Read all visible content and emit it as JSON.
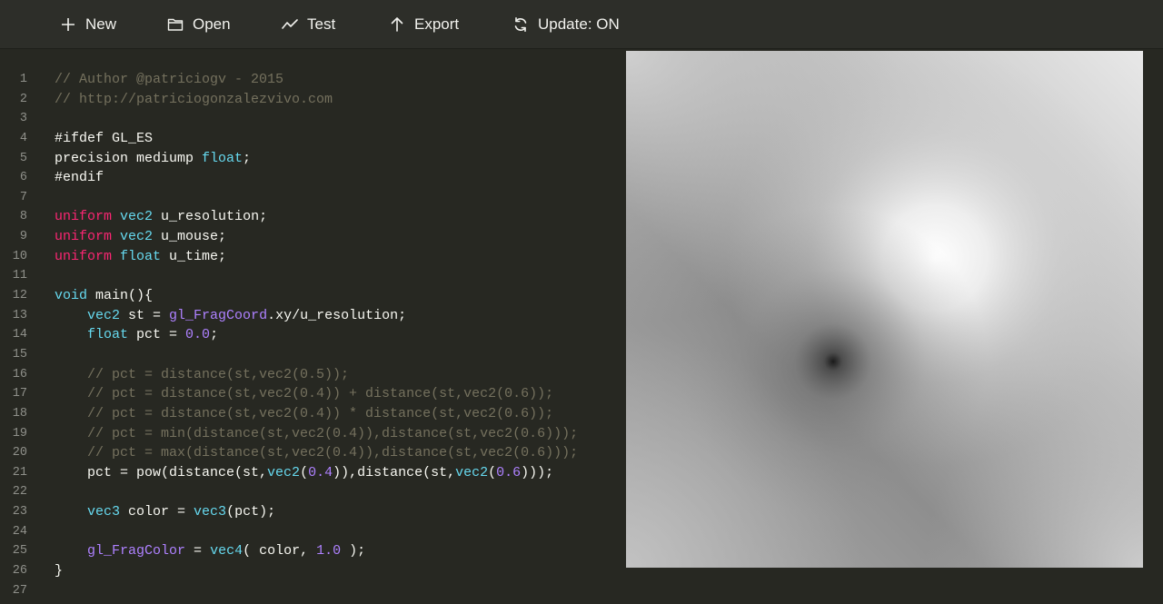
{
  "toolbar": {
    "new_label": "New",
    "open_label": "Open",
    "test_label": "Test",
    "export_label": "Export",
    "update_label": "Update: ON"
  },
  "editor": {
    "line_numbers": [
      "1",
      "2",
      "3",
      "4",
      "5",
      "6",
      "7",
      "8",
      "9",
      "10",
      "11",
      "12",
      "13",
      "14",
      "15",
      "16",
      "17",
      "18",
      "19",
      "20",
      "21",
      "22",
      "23",
      "24",
      "25",
      "26",
      "27"
    ],
    "lines": [
      [
        {
          "t": "// Author @patriciogv - 2015",
          "c": "comment"
        }
      ],
      [
        {
          "t": "// http://patriciogonzalezvivo.com",
          "c": "comment"
        }
      ],
      [],
      [
        {
          "t": "#ifdef GL_ES",
          "c": "plain"
        }
      ],
      [
        {
          "t": "precision mediump ",
          "c": "plain"
        },
        {
          "t": "float",
          "c": "type"
        },
        {
          "t": ";",
          "c": "plain"
        }
      ],
      [
        {
          "t": "#endif",
          "c": "plain"
        }
      ],
      [],
      [
        {
          "t": "uniform",
          "c": "kw"
        },
        {
          "t": " ",
          "c": "plain"
        },
        {
          "t": "vec2",
          "c": "type"
        },
        {
          "t": " u_resolution;",
          "c": "plain"
        }
      ],
      [
        {
          "t": "uniform",
          "c": "kw"
        },
        {
          "t": " ",
          "c": "plain"
        },
        {
          "t": "vec2",
          "c": "type"
        },
        {
          "t": " u_mouse;",
          "c": "plain"
        }
      ],
      [
        {
          "t": "uniform",
          "c": "kw"
        },
        {
          "t": " ",
          "c": "plain"
        },
        {
          "t": "float",
          "c": "type"
        },
        {
          "t": " u_time;",
          "c": "plain"
        }
      ],
      [],
      [
        {
          "t": "void",
          "c": "type"
        },
        {
          "t": " main(){",
          "c": "plain"
        }
      ],
      [
        {
          "t": "    ",
          "c": "plain"
        },
        {
          "t": "vec2",
          "c": "type"
        },
        {
          "t": " st = ",
          "c": "plain"
        },
        {
          "t": "gl_FragCoord",
          "c": "builtin"
        },
        {
          "t": ".xy/u_resolution;",
          "c": "plain"
        }
      ],
      [
        {
          "t": "    ",
          "c": "plain"
        },
        {
          "t": "float",
          "c": "type"
        },
        {
          "t": " pct = ",
          "c": "plain"
        },
        {
          "t": "0.0",
          "c": "num"
        },
        {
          "t": ";",
          "c": "plain"
        }
      ],
      [],
      [
        {
          "t": "    // pct = distance(st,vec2(0.5));",
          "c": "comment"
        }
      ],
      [
        {
          "t": "    // pct = distance(st,vec2(0.4)) + distance(st,vec2(0.6));",
          "c": "comment"
        }
      ],
      [
        {
          "t": "    // pct = distance(st,vec2(0.4)) * distance(st,vec2(0.6));",
          "c": "comment"
        }
      ],
      [
        {
          "t": "    // pct = min(distance(st,vec2(0.4)),distance(st,vec2(0.6)));",
          "c": "comment"
        }
      ],
      [
        {
          "t": "    // pct = max(distance(st,vec2(0.4)),distance(st,vec2(0.6)));",
          "c": "comment"
        }
      ],
      [
        {
          "t": "    pct = pow(distance(st,",
          "c": "plain"
        },
        {
          "t": "vec2",
          "c": "type"
        },
        {
          "t": "(",
          "c": "plain"
        },
        {
          "t": "0.4",
          "c": "num"
        },
        {
          "t": ")),distance(st,",
          "c": "plain"
        },
        {
          "t": "vec2",
          "c": "type"
        },
        {
          "t": "(",
          "c": "plain"
        },
        {
          "t": "0.6",
          "c": "num"
        },
        {
          "t": ")));",
          "c": "plain"
        }
      ],
      [],
      [
        {
          "t": "    ",
          "c": "plain"
        },
        {
          "t": "vec3",
          "c": "type"
        },
        {
          "t": " color = ",
          "c": "plain"
        },
        {
          "t": "vec3",
          "c": "type"
        },
        {
          "t": "(pct);",
          "c": "plain"
        }
      ],
      [],
      [
        {
          "t": "    ",
          "c": "plain"
        },
        {
          "t": "gl_FragColor",
          "c": "builtin"
        },
        {
          "t": " = ",
          "c": "plain"
        },
        {
          "t": "vec4",
          "c": "type"
        },
        {
          "t": "( color, ",
          "c": "plain"
        },
        {
          "t": "1.0",
          "c": "num"
        },
        {
          "t": " );",
          "c": "plain"
        }
      ],
      [
        {
          "t": "}",
          "c": "plain"
        }
      ],
      []
    ]
  },
  "colors": {
    "toolbar_bg": "#2d2e29",
    "editor_bg": "#272822",
    "comment": "#75715e",
    "keyword": "#f92672",
    "type": "#66d9ef",
    "number": "#ae81ff"
  },
  "icons": {
    "new": "plus-icon",
    "open": "folder-icon",
    "test": "chart-line-icon",
    "export": "arrow-up-icon",
    "update": "refresh-icon"
  }
}
